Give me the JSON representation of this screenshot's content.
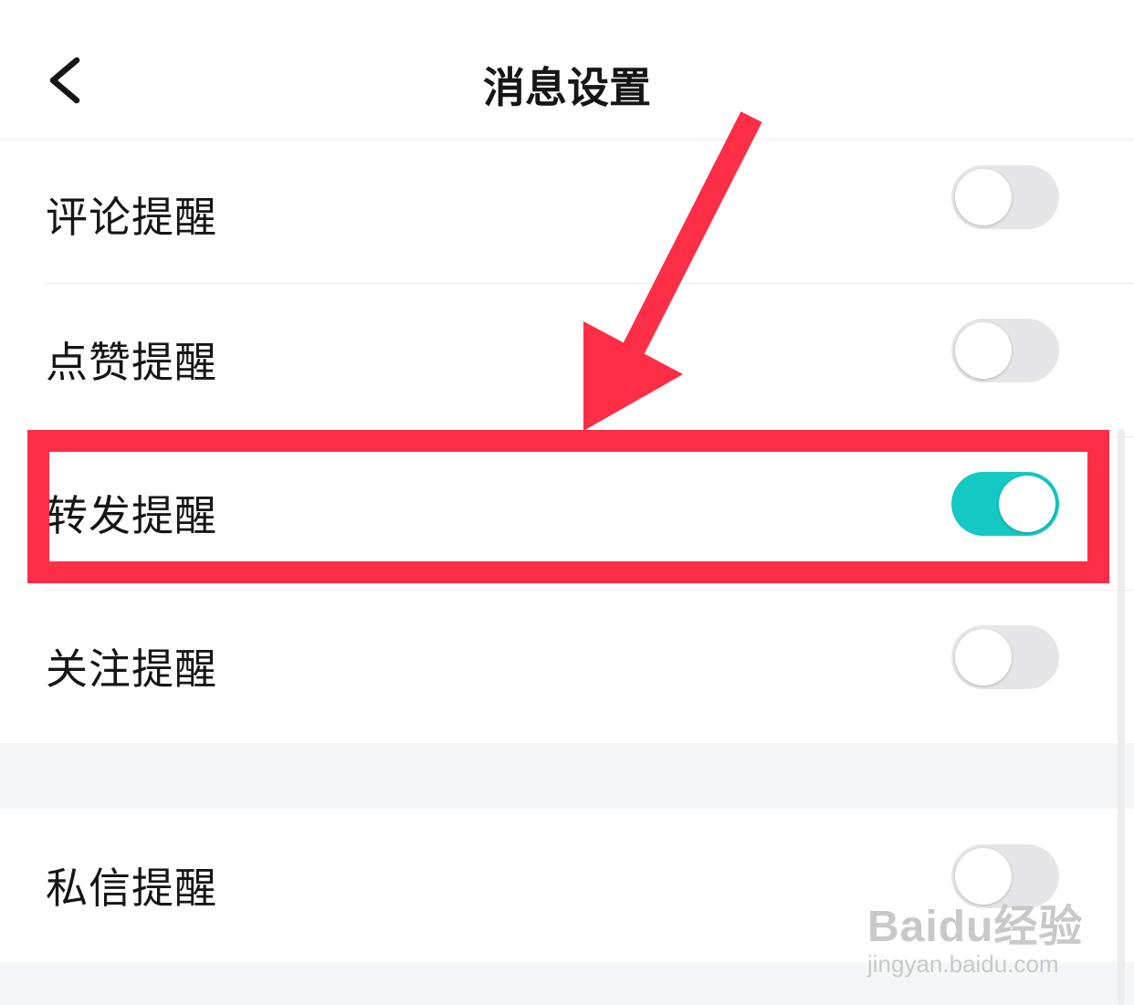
{
  "header": {
    "title": "消息设置",
    "back_icon": "chevron-left-icon"
  },
  "settings": [
    {
      "label": "评论提醒",
      "enabled": false
    },
    {
      "label": "点赞提醒",
      "enabled": false
    },
    {
      "label": "转发提醒",
      "enabled": true
    },
    {
      "label": "关注提醒",
      "enabled": false
    },
    {
      "label": "私信提醒",
      "enabled": false
    }
  ],
  "annotation": {
    "color": "#fd2e46",
    "highlighted_item": "转发提醒"
  },
  "colors": {
    "toggle_on": "#14c8c4",
    "toggle_off": "#e6e6e8",
    "section_gap": "#f5f6f7"
  },
  "watermark": {
    "brand": "Baidu经验",
    "url": "jingyan.baidu.com"
  }
}
